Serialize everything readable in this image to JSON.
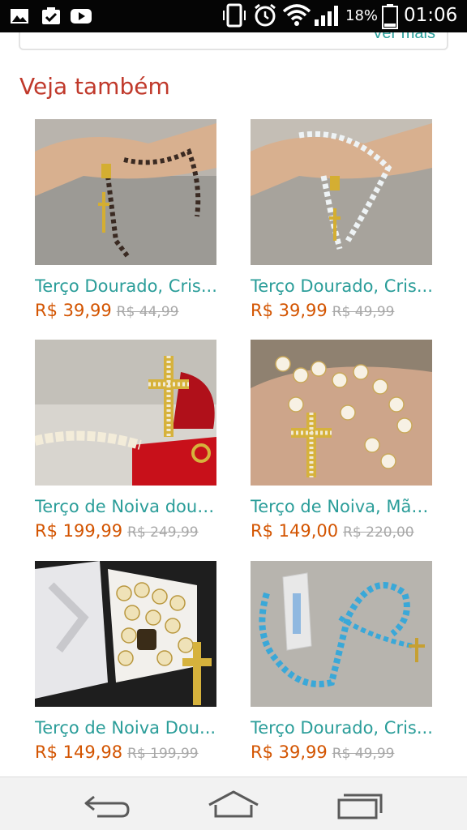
{
  "status_bar": {
    "battery_percent": "18%",
    "time": "01:06",
    "icons": [
      "image-icon",
      "clipboard-check-icon",
      "youtube-icon",
      "phone-vibrate-icon",
      "alarm-icon",
      "wifi-icon",
      "signal-icon",
      "battery-icon"
    ]
  },
  "previous_section": {
    "see_more_label": "Ver mais"
  },
  "section": {
    "title": "Veja também"
  },
  "products": [
    {
      "name": "Terço Dourado, Cris...",
      "price": "R$ 39,99",
      "old_price": "R$ 44,99",
      "colors": {
        "bead": "#3a2a22",
        "bg": "#9a9a9a"
      }
    },
    {
      "name": "Terço Dourado, Cris...",
      "price": "R$ 39,99",
      "old_price": "R$ 49,99",
      "colors": {
        "bead": "#e8eef0",
        "bg": "#a7a39c"
      }
    },
    {
      "name": "Terço de Noiva dour...",
      "price": "R$ 199,99",
      "old_price": "R$ 249,99",
      "colors": {
        "bead": "#f3ecd9",
        "bg": "#d8d5cf"
      }
    },
    {
      "name": "Terço de Noiva, Mãe...",
      "price": "R$ 149,00",
      "old_price": "R$ 220,00",
      "colors": {
        "bead": "#f7f1e4",
        "bg": "#9a8c7c"
      }
    },
    {
      "name": "Terço de Noiva Dou...",
      "price": "R$ 149,98",
      "old_price": "R$ 199,99",
      "colors": {
        "bead": "#efe2b8",
        "bg": "#3a3a3a"
      }
    },
    {
      "name": "Terço Dourado, Cris...",
      "price": "R$ 39,99",
      "old_price": "R$ 49,99",
      "colors": {
        "bead": "#3aa8d8",
        "bg": "#b7b4ae"
      }
    }
  ],
  "nav_bar": {
    "buttons": [
      "back-icon",
      "home-icon",
      "recent-apps-icon"
    ]
  },
  "theme": {
    "accent": "#2a9d99",
    "price": "#d35400",
    "title": "#c0392b"
  }
}
